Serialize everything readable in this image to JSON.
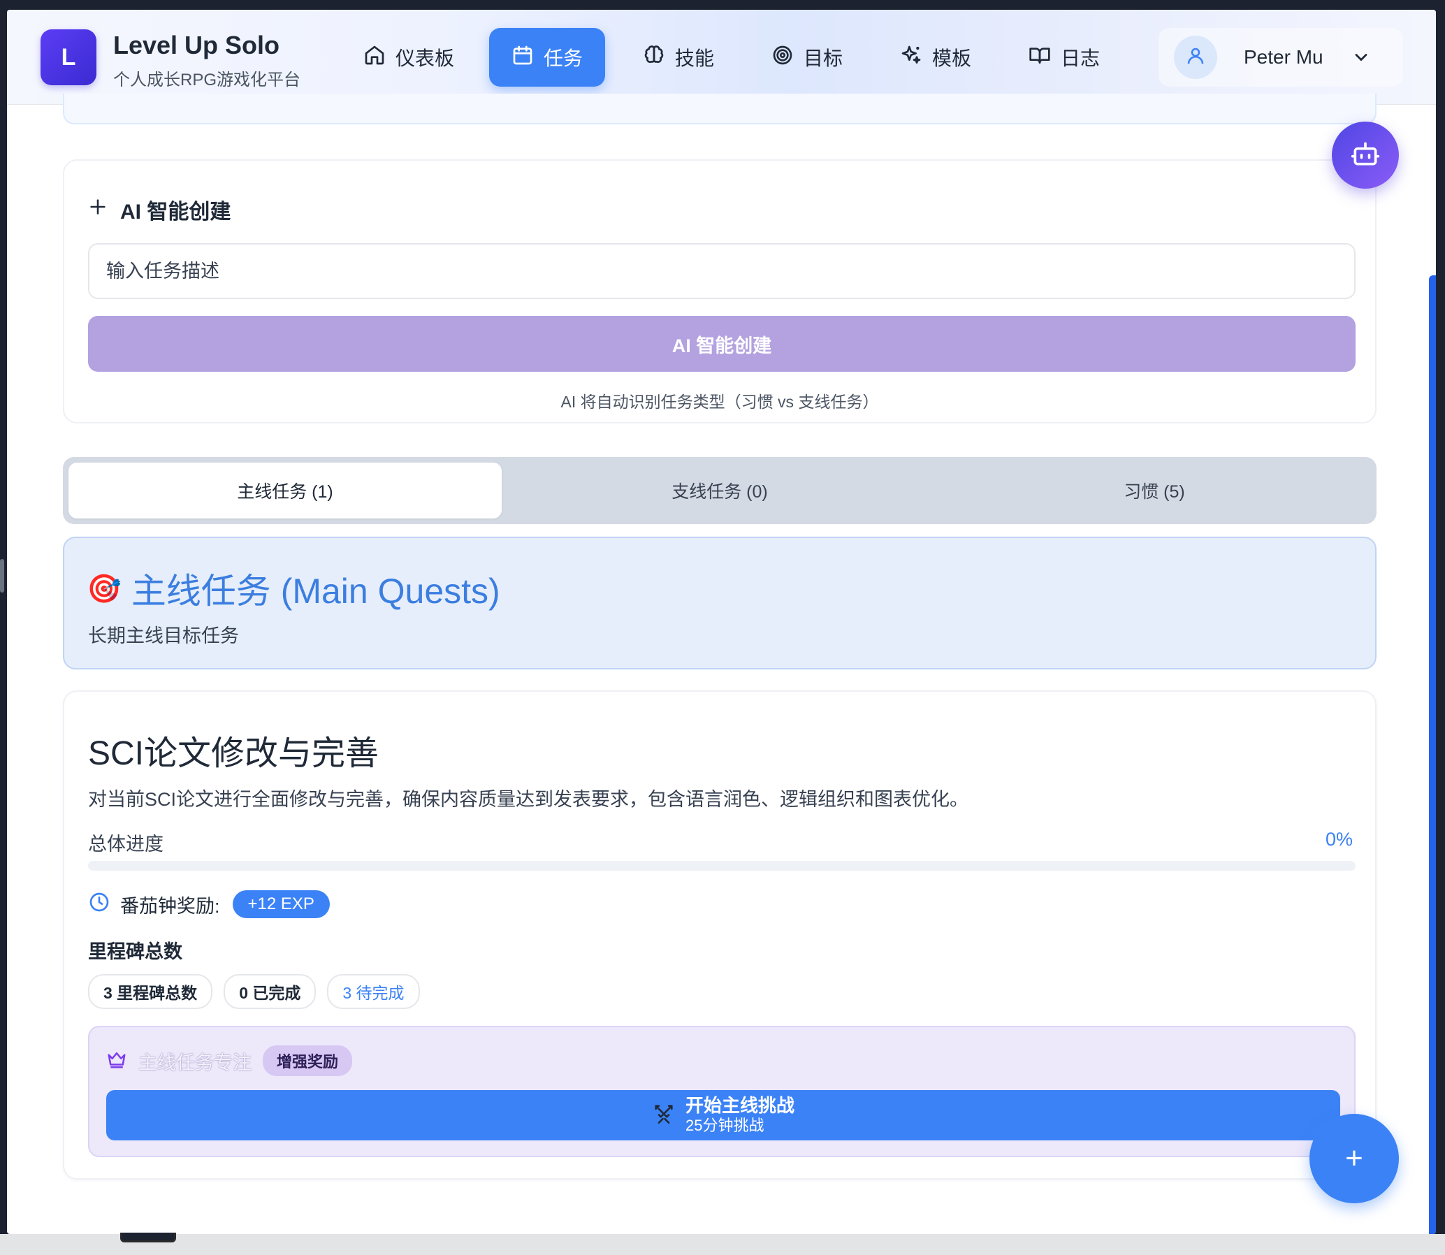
{
  "app": {
    "logo_letter": "L",
    "title": "Level Up Solo",
    "subtitle": "个人成长RPG游戏化平台"
  },
  "nav": {
    "items": [
      {
        "label": "仪表板",
        "icon": "home-icon"
      },
      {
        "label": "任务",
        "icon": "calendar-icon",
        "active": true
      },
      {
        "label": "技能",
        "icon": "brain-icon"
      },
      {
        "label": "目标",
        "icon": "target-icon"
      },
      {
        "label": "模板",
        "icon": "sparkles-icon"
      },
      {
        "label": "日志",
        "icon": "book-open-icon"
      }
    ]
  },
  "user": {
    "name": "Peter Mu",
    "icon": "user-icon"
  },
  "ai_create": {
    "title": "AI 智能创建",
    "input_placeholder": "输入任务描述",
    "button_label": "AI 智能创建",
    "hint": "AI 将自动识别任务类型（习惯 vs 支线任务）"
  },
  "tabs": [
    {
      "label": "主线任务 (1)",
      "active": true
    },
    {
      "label": "支线任务 (0)"
    },
    {
      "label": "习惯 (5)"
    }
  ],
  "main_quests": {
    "emoji": "🎯",
    "title": "主线任务 (Main Quests)",
    "subtitle": "长期主线目标任务"
  },
  "quest": {
    "title": "SCI论文修改与完善",
    "description": "对当前SCI论文进行全面修改与完善，确保内容质量达到发表要求，包含语言润色、逻辑组织和图表优化。",
    "progress_label": "总体进度",
    "progress_value": "0%",
    "progress_fraction": 0,
    "reward_label": "番茄钟奖励:",
    "reward_exp": "+12 EXP",
    "milestones_title": "里程碑总数",
    "milestones": {
      "total": "3 里程碑总数",
      "completed": "0 已完成",
      "pending": "3 待完成"
    },
    "focus": {
      "title": "主线任务专注",
      "badge": "增强奖励",
      "button_main": "开始主线挑战",
      "button_sub": "25分钟挑战"
    }
  },
  "colors": {
    "primary": "#3b82f6",
    "logo": "#4f36e8",
    "ai_button": "#b3a1e0",
    "focus_bg": "#ede8fa"
  },
  "fab": {
    "plus": "+"
  }
}
